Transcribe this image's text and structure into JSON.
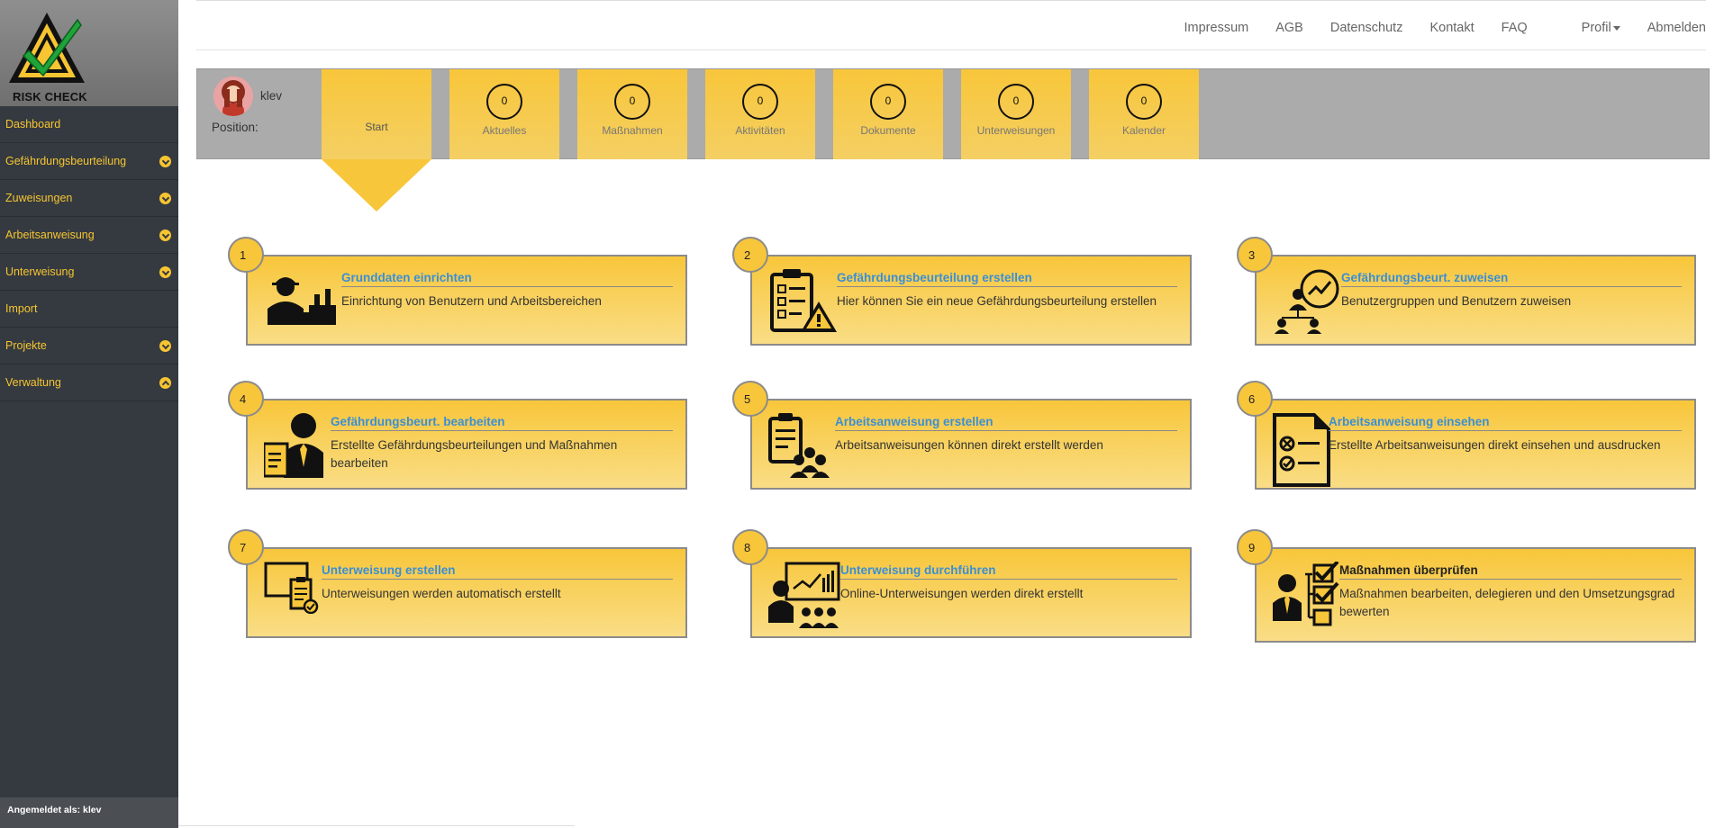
{
  "brand": {
    "logo_text": "RISK CHECK"
  },
  "sidebar": {
    "items": [
      {
        "label": "Dashboard",
        "chevron": "none"
      },
      {
        "label": "Gefährdungsbeurteilung",
        "chevron": "down"
      },
      {
        "label": "Zuweisungen",
        "chevron": "down"
      },
      {
        "label": "Arbeitsanweisung",
        "chevron": "down"
      },
      {
        "label": "Unterweisung",
        "chevron": "down"
      },
      {
        "label": "Import",
        "chevron": "none"
      },
      {
        "label": "Projekte",
        "chevron": "down"
      },
      {
        "label": "Verwaltung",
        "chevron": "up"
      }
    ],
    "footer": "Angemeldet als: klev"
  },
  "topnav": {
    "links": [
      "Impressum",
      "AGB",
      "Datenschutz",
      "Kontakt",
      "FAQ",
      "Profil",
      "Abmelden"
    ]
  },
  "header": {
    "user_name": "klev",
    "position_label": "Position:",
    "start_label": "Start",
    "tiles": [
      {
        "label": "Aktuelles",
        "count": "0"
      },
      {
        "label": "Maßnahmen",
        "count": "0"
      },
      {
        "label": "Aktivitäten",
        "count": "0"
      },
      {
        "label": "Dokumente",
        "count": "0"
      },
      {
        "label": "Unterweisungen",
        "count": "0"
      },
      {
        "label": "Kalender",
        "count": "0"
      }
    ]
  },
  "cards": [
    {
      "num": "1",
      "title": "Grunddaten einrichten",
      "desc": "Einrichtung von Benutzern und Arbeitsbereichen",
      "icon": "worker-factory-icon"
    },
    {
      "num": "2",
      "title": "Gefährdungsbeurteilung erstellen",
      "desc": "Hier können Sie ein neue Gefährdungsbeurteilung erstellen",
      "icon": "checklist-warning-icon"
    },
    {
      "num": "3",
      "title": "Gefährdungsbeurt. zuweisen",
      "desc": "Benutzergruppen und Benutzern zuweisen",
      "icon": "team-assign-icon"
    },
    {
      "num": "4",
      "title": "Gefährdungsbeurt. bearbeiten",
      "desc": "Erstellte Gefährdungsbeurteilungen und Maßnahmen bearbeiten",
      "icon": "person-edit-document-icon"
    },
    {
      "num": "5",
      "title": "Arbeitsanweisung erstellen",
      "desc": "Arbeitsanweisungen können direkt erstellt werden",
      "icon": "clipboard-group-icon"
    },
    {
      "num": "6",
      "title": "Arbeitsanweisung einsehen",
      "desc": "Erstellte Arbeitsanweisungen direkt einsehen und ausdrucken",
      "icon": "document-check-icon"
    },
    {
      "num": "7",
      "title": "Unterweisung erstellen",
      "desc": "Unterweisungen werden automatisch erstellt",
      "icon": "screen-clipboard-icon"
    },
    {
      "num": "8",
      "title": "Unterweisung durchführen",
      "desc": "Online-Unterweisungen werden direkt erstellt",
      "icon": "presentation-audience-icon"
    },
    {
      "num": "9",
      "title": "Maßnahmen überprüfen",
      "desc": "Maßnahmen bearbeiten, delegieren und den Umsetzungsgrad bewerten",
      "icon": "person-checklist-icon"
    }
  ]
}
